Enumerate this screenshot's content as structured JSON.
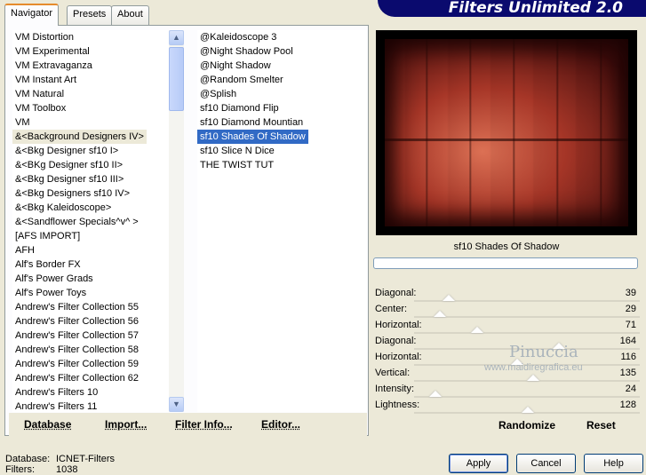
{
  "tabs": [
    {
      "label": "Navigator",
      "active": true
    },
    {
      "label": "Presets",
      "active": false
    },
    {
      "label": "About",
      "active": false
    }
  ],
  "title": "Filters Unlimited 2.0",
  "categories": [
    {
      "label": "VM Distortion",
      "state": ""
    },
    {
      "label": "VM Experimental",
      "state": ""
    },
    {
      "label": "VM Extravaganza",
      "state": ""
    },
    {
      "label": "VM Instant Art",
      "state": ""
    },
    {
      "label": "VM Natural",
      "state": ""
    },
    {
      "label": "VM Toolbox",
      "state": ""
    },
    {
      "label": "VM",
      "state": ""
    },
    {
      "label": "&<Background Designers IV>",
      "state": "selected"
    },
    {
      "label": "&<Bkg Designer sf10 I>",
      "state": ""
    },
    {
      "label": "&<BKg Designer sf10 II>",
      "state": ""
    },
    {
      "label": "&<Bkg Designer sf10 III>",
      "state": ""
    },
    {
      "label": "&<Bkg Designers sf10 IV>",
      "state": ""
    },
    {
      "label": "&<Bkg Kaleidoscope>",
      "state": ""
    },
    {
      "label": "&<Sandflower Specials^v^ >",
      "state": ""
    },
    {
      "label": "[AFS IMPORT]",
      "state": ""
    },
    {
      "label": "AFH",
      "state": ""
    },
    {
      "label": "Alf's Border FX",
      "state": ""
    },
    {
      "label": "Alf's Power Grads",
      "state": ""
    },
    {
      "label": "Alf's Power Toys",
      "state": ""
    },
    {
      "label": "Andrew's Filter Collection 55",
      "state": ""
    },
    {
      "label": "Andrew's Filter Collection 56",
      "state": ""
    },
    {
      "label": "Andrew's Filter Collection 57",
      "state": ""
    },
    {
      "label": "Andrew's Filter Collection 58",
      "state": ""
    },
    {
      "label": "Andrew's Filter Collection 59",
      "state": ""
    },
    {
      "label": "Andrew's Filter Collection 62",
      "state": ""
    },
    {
      "label": "Andrew's Filters 10",
      "state": ""
    },
    {
      "label": "Andrew's Filters 11",
      "state": ""
    }
  ],
  "filters": [
    {
      "label": "@Kaleidoscope 3",
      "state": ""
    },
    {
      "label": "@Night Shadow Pool",
      "state": ""
    },
    {
      "label": "@Night Shadow",
      "state": ""
    },
    {
      "label": "@Random Smelter",
      "state": ""
    },
    {
      "label": "@Splish",
      "state": ""
    },
    {
      "label": "sf10 Diamond Flip",
      "state": ""
    },
    {
      "label": "sf10 Diamond Mountian",
      "state": ""
    },
    {
      "label": "sf10 Shades Of Shadow",
      "state": "active"
    },
    {
      "label": "sf10 Slice N Dice",
      "state": ""
    },
    {
      "label": "THE TWIST TUT",
      "state": ""
    }
  ],
  "left_buttons": {
    "database": "Database",
    "import": "Import...",
    "filter_info": "Filter Info...",
    "editor": "Editor..."
  },
  "preview_title": "sf10 Shades Of Shadow",
  "parameters": [
    {
      "label": "Diagonal:",
      "value": "39",
      "level": 0.153
    },
    {
      "label": "Center:",
      "value": "29",
      "level": 0.114
    },
    {
      "label": "Horizontal:",
      "value": "71",
      "level": 0.278
    },
    {
      "label": "Diagonal:",
      "value": "164",
      "level": 0.643
    },
    {
      "label": "Horizontal:",
      "value": "116",
      "level": 0.455
    },
    {
      "label": "Vertical:",
      "value": "135",
      "level": 0.529
    },
    {
      "label": "Intensity:",
      "value": "24",
      "level": 0.094
    },
    {
      "label": "Lightness:",
      "value": "128",
      "level": 0.502
    }
  ],
  "right_buttons": {
    "randomize": "Randomize",
    "reset": "Reset"
  },
  "watermark": {
    "line1": "Pinuccia",
    "line2": "www.maidiregrafica.eu"
  },
  "footer": {
    "database_label": "Database:",
    "database_value": "ICNET-Filters",
    "filters_label": "Filters:",
    "filters_value": "1038"
  },
  "dialog_buttons": {
    "apply": "Apply",
    "cancel": "Cancel",
    "help": "Help"
  }
}
